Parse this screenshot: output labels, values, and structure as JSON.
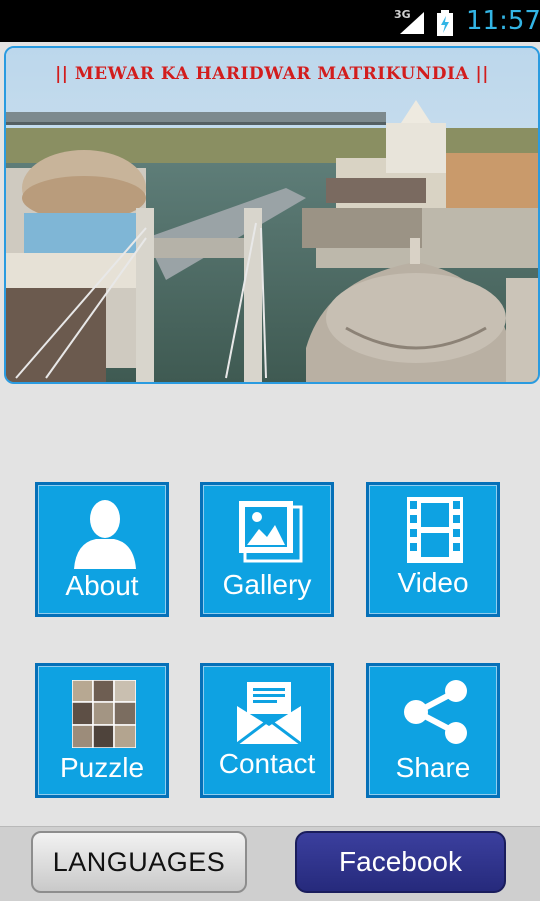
{
  "status_bar": {
    "network": "3G",
    "time": "11:57",
    "signal_icon": "signal-icon",
    "battery_icon": "battery-charging-icon"
  },
  "banner": {
    "title": "|| MEWAR KA HARIDWAR MATRIKUNDIA ||"
  },
  "tiles": [
    {
      "label": "About",
      "icon": "person-icon"
    },
    {
      "label": "Gallery",
      "icon": "gallery-icon"
    },
    {
      "label": "Video",
      "icon": "film-icon"
    },
    {
      "label": "Puzzle",
      "icon": "puzzle-icon"
    },
    {
      "label": "Contact",
      "icon": "envelope-icon"
    },
    {
      "label": "Share",
      "icon": "share-icon"
    }
  ],
  "bottom": {
    "languages_label": "LANGUAGES",
    "facebook_label": "Facebook"
  },
  "colors": {
    "tile": "#0ea2e2",
    "tile_border": "#0570b8",
    "facebook": "#2d3187",
    "banner_title": "#d21d1d"
  }
}
